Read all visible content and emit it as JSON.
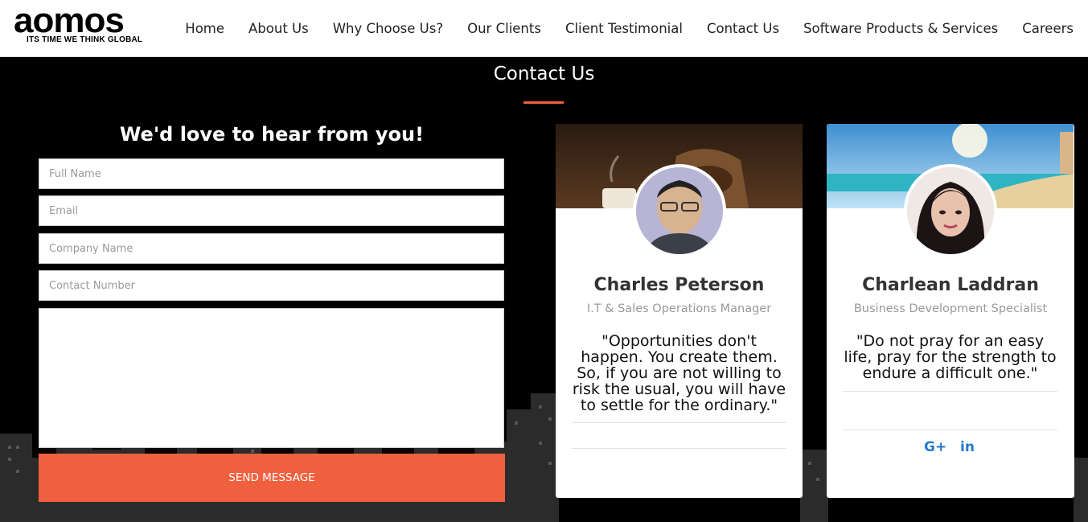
{
  "header": {
    "logo_word": "aomos",
    "logo_tagline": "ITS TIME WE THINK GLOBAL",
    "nav": [
      {
        "label": "Home"
      },
      {
        "label": "About Us"
      },
      {
        "label": "Why Choose Us?"
      },
      {
        "label": "Our Clients"
      },
      {
        "label": "Client Testimonial"
      },
      {
        "label": "Contact Us"
      },
      {
        "label": "Software Products & Services"
      },
      {
        "label": "Careers"
      }
    ]
  },
  "section": {
    "title": "Contact Us",
    "accent_color": "#f0603e"
  },
  "form": {
    "heading": "We'd love to hear from you!",
    "full_name_placeholder": "Full Name",
    "email_placeholder": "Email",
    "company_placeholder": "Company Name",
    "contact_placeholder": "Contact Number",
    "message_value": "",
    "send_label": "SEND MESSAGE"
  },
  "contacts": [
    {
      "name": "Charles Peterson",
      "role": "I.T & Sales Operations Manager",
      "quote": "\"Opportunities don't happen. You create them. So, if you are not willing to risk the usual, you will have to settle for the ordinary.\"",
      "socials": []
    },
    {
      "name": "Charlean Laddran",
      "role": "Business Development Specialist",
      "quote": "\"Do not pray for an easy life, pray for the strength to endure a difficult one.\"",
      "socials": [
        {
          "icon": "google-plus-icon",
          "label": "G+"
        },
        {
          "icon": "linkedin-icon",
          "label": "in"
        }
      ]
    }
  ],
  "colors": {
    "accent": "#f0603e",
    "social": "#2779d0"
  }
}
